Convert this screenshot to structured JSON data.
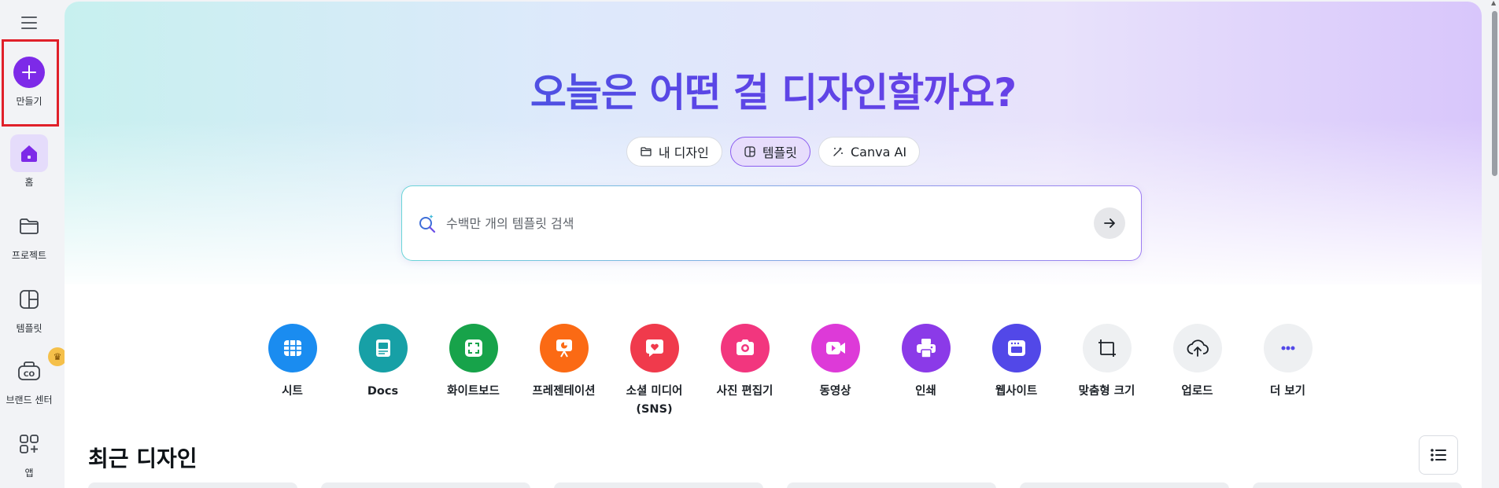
{
  "sidebar": {
    "items": [
      {
        "label": "만들기"
      },
      {
        "label": "홈"
      },
      {
        "label": "프로젝트"
      },
      {
        "label": "템플릿"
      },
      {
        "label": "브랜드 센터"
      },
      {
        "label": "앱"
      }
    ]
  },
  "hero": {
    "headline": "오늘은 어떤 걸 디자인할까요?",
    "tabs": [
      {
        "label": "내 디자인"
      },
      {
        "label": "템플릿"
      },
      {
        "label": "Canva AI"
      }
    ],
    "active_tab": "템플릿",
    "search": {
      "placeholder": "수백만 개의 템플릿 검색",
      "value": ""
    }
  },
  "categories": [
    {
      "label": "시트",
      "color": "#1a8cf0",
      "icon": "sheet-icon"
    },
    {
      "label": "Docs",
      "color": "#17a0a6",
      "icon": "docs-icon"
    },
    {
      "label": "화이트보드",
      "color": "#17a34a",
      "icon": "whiteboard-icon"
    },
    {
      "label": "프레젠테이션",
      "color": "#fb6a14",
      "icon": "presentation-icon"
    },
    {
      "label": "소셜 미디어",
      "label2": "(SNS)",
      "color": "#f03a4c",
      "icon": "heart-icon"
    },
    {
      "label": "사진 편집기",
      "color": "#f2367e",
      "icon": "camera-icon"
    },
    {
      "label": "동영상",
      "color": "#dd3ad8",
      "icon": "video-icon"
    },
    {
      "label": "인쇄",
      "color": "#8b3ae8",
      "icon": "printer-icon"
    },
    {
      "label": "웹사이트",
      "color": "#5248e8",
      "icon": "website-icon"
    },
    {
      "label": "맞춤형 크기",
      "color": "#eef0f2",
      "icon": "resize-icon"
    },
    {
      "label": "업로드",
      "color": "#eef0f2",
      "icon": "upload-icon"
    },
    {
      "label": "더 보기",
      "color": "#eef0f2",
      "icon": "more-icon"
    }
  ],
  "recent": {
    "title": "최근 디자인"
  },
  "colors": {
    "accent": "#7d2ae8",
    "highlight_border": "#e0202a"
  }
}
